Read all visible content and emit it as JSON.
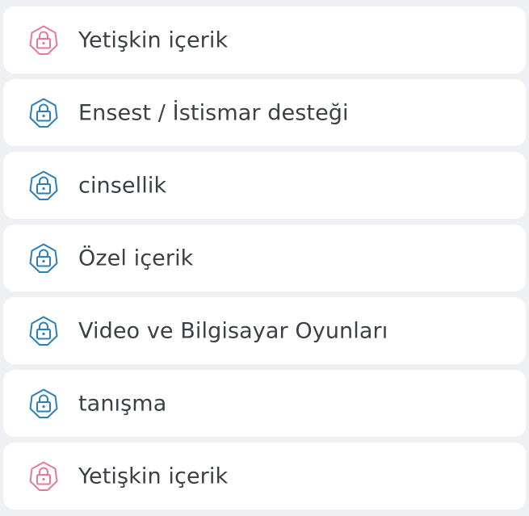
{
  "colors": {
    "background": "#eef0f4",
    "row_background": "#ffffff",
    "text": "#3b3f46",
    "lock_pink": "#e57a97",
    "lock_blue": "#2d7fb8"
  },
  "categories": [
    {
      "label": "Yetişkin içerik",
      "icon": "padlock-icon",
      "icon_color": "#e57a97"
    },
    {
      "label": "Ensest / İstismar desteği",
      "icon": "padlock-icon",
      "icon_color": "#2d7fb8"
    },
    {
      "label": "cinsellik",
      "icon": "padlock-icon",
      "icon_color": "#2d7fb8"
    },
    {
      "label": "Özel içerik",
      "icon": "padlock-icon",
      "icon_color": "#2d7fb8"
    },
    {
      "label": "Video ve Bilgisayar Oyunları",
      "icon": "padlock-icon",
      "icon_color": "#2d7fb8"
    },
    {
      "label": "tanışma",
      "icon": "padlock-icon",
      "icon_color": "#2d7fb8"
    },
    {
      "label": "Yetişkin içerik",
      "icon": "padlock-icon",
      "icon_color": "#e57a97"
    }
  ]
}
